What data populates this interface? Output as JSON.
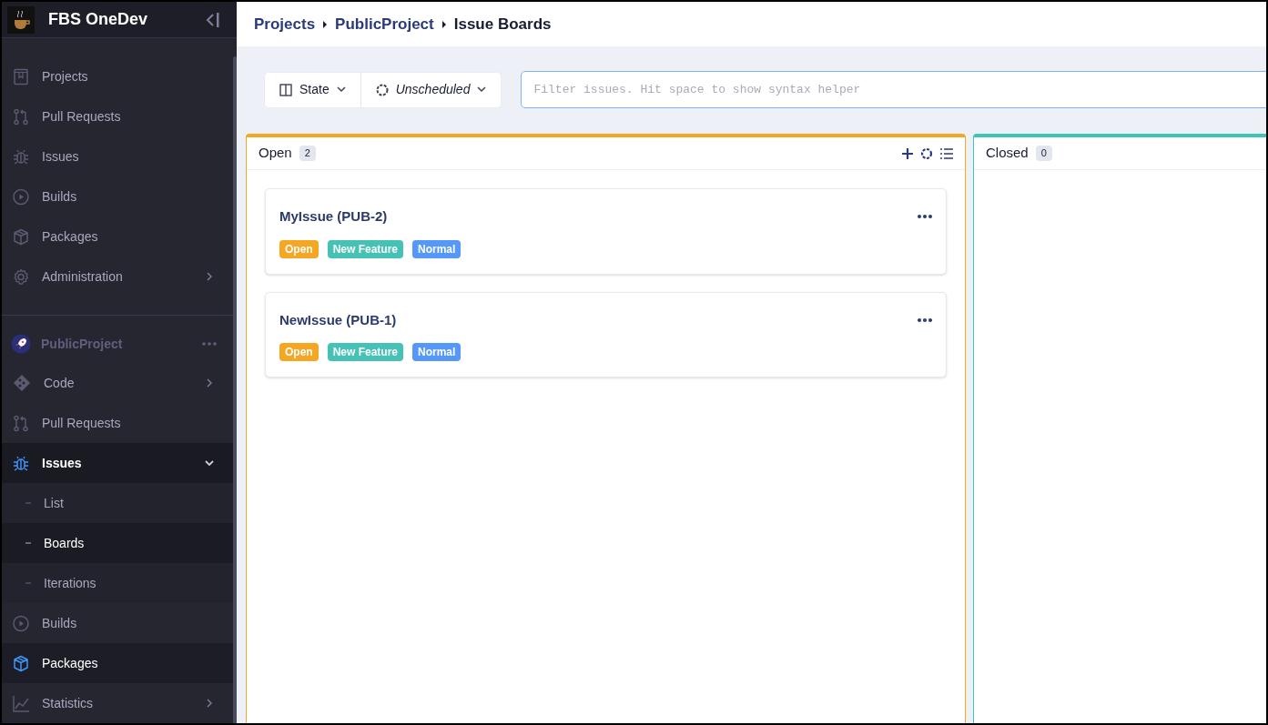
{
  "brand": {
    "name": "FBS OneDev"
  },
  "breadcrumbs": [
    "Projects",
    "PublicProject",
    "Issue Boards"
  ],
  "nav": {
    "items": [
      {
        "label": "Projects",
        "has_submenu": false
      },
      {
        "label": "Pull Requests",
        "has_submenu": false
      },
      {
        "label": "Issues",
        "has_submenu": false
      },
      {
        "label": "Builds",
        "has_submenu": false
      },
      {
        "label": "Packages",
        "has_submenu": false
      },
      {
        "label": "Administration",
        "has_submenu": true
      }
    ]
  },
  "project": {
    "name": "PublicProject",
    "items": [
      {
        "label": "Code",
        "has_submenu": true,
        "selected": false,
        "hovered": false
      },
      {
        "label": "Pull Requests",
        "has_submenu": false,
        "selected": false,
        "hovered": false
      },
      {
        "label": "Issues",
        "has_submenu": true,
        "selected": true,
        "hovered": false,
        "expanded": true,
        "children": [
          {
            "label": "List",
            "selected": false
          },
          {
            "label": "Boards",
            "selected": true
          },
          {
            "label": "Iterations",
            "selected": false
          }
        ]
      },
      {
        "label": "Builds",
        "has_submenu": false,
        "selected": false,
        "hovered": false
      },
      {
        "label": "Packages",
        "has_submenu": false,
        "selected": false,
        "hovered": true
      },
      {
        "label": "Statistics",
        "has_submenu": true,
        "selected": false,
        "hovered": false
      }
    ]
  },
  "toolbar": {
    "group_by": "State",
    "iteration": "Unscheduled",
    "filter": {
      "placeholder": "Filter issues. Hit space to show syntax helper"
    }
  },
  "columns": [
    {
      "title": "Open",
      "count": "2",
      "color": "#f5a623",
      "actions": true,
      "cards": [
        {
          "title": "MyIssue (PUB-2)",
          "tags": [
            {
              "label": "Open",
              "color": "#f5a623"
            },
            {
              "label": "New Feature",
              "color": "#45c1b5"
            },
            {
              "label": "Normal",
              "color": "#5598f7"
            }
          ]
        },
        {
          "title": "NewIssue (PUB-1)",
          "tags": [
            {
              "label": "Open",
              "color": "#f5a623"
            },
            {
              "label": "New Feature",
              "color": "#45c1b5"
            },
            {
              "label": "Normal",
              "color": "#5598f7"
            }
          ]
        }
      ]
    },
    {
      "title": "Closed",
      "count": "0",
      "color": "#3ec4b8",
      "actions": false
    }
  ]
}
